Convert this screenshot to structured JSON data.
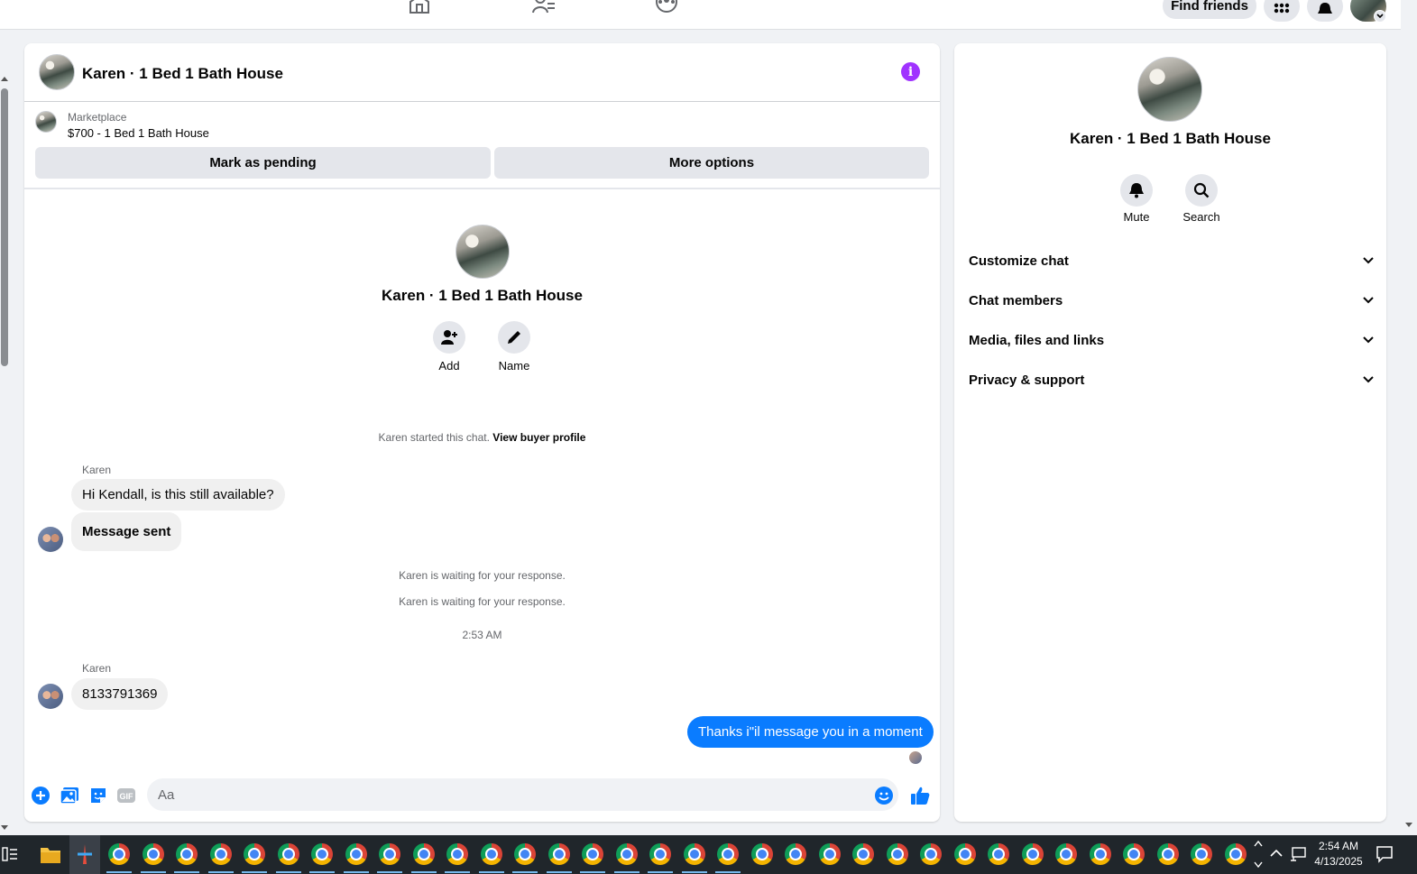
{
  "topbar": {
    "find_friends_label": "Find friends"
  },
  "chat": {
    "title": "Karen · 1 Bed 1 Bath House",
    "marketplace": {
      "label": "Marketplace",
      "item": "$700 - 1 Bed 1 Bath House",
      "mark_pending_label": "Mark as pending",
      "more_options_label": "More options"
    },
    "intro": {
      "name": "Karen · 1 Bed 1 Bath House",
      "add_label": "Add",
      "name_label": "Name"
    },
    "started_text": "Karen started this chat.",
    "view_buyer_profile": "View buyer profile",
    "messages": {
      "sender_1": "Karen",
      "msg_1": "Hi Kendall, is this still available?",
      "msg_2": "Message sent",
      "waiting_1": "Karen is waiting for your response.",
      "waiting_2": "Karen is waiting for your response.",
      "timestamp": "2:53 AM",
      "sender_2": "Karen",
      "msg_3": "8133791369",
      "msg_out": "Thanks i\"il message you in a moment"
    },
    "composer": {
      "placeholder": "Aa"
    }
  },
  "details": {
    "name": "Karen · 1 Bed 1 Bath House",
    "mute_label": "Mute",
    "search_label": "Search",
    "sections": [
      "Customize chat",
      "Chat members",
      "Media, files and links",
      "Privacy & support"
    ]
  },
  "taskbar": {
    "time": "2:54 AM",
    "date": "4/13/2025"
  },
  "colors": {
    "accent_blue": "#0a7cff",
    "info_purple": "#a033ff",
    "bubble_grey": "#f0f0f0"
  }
}
